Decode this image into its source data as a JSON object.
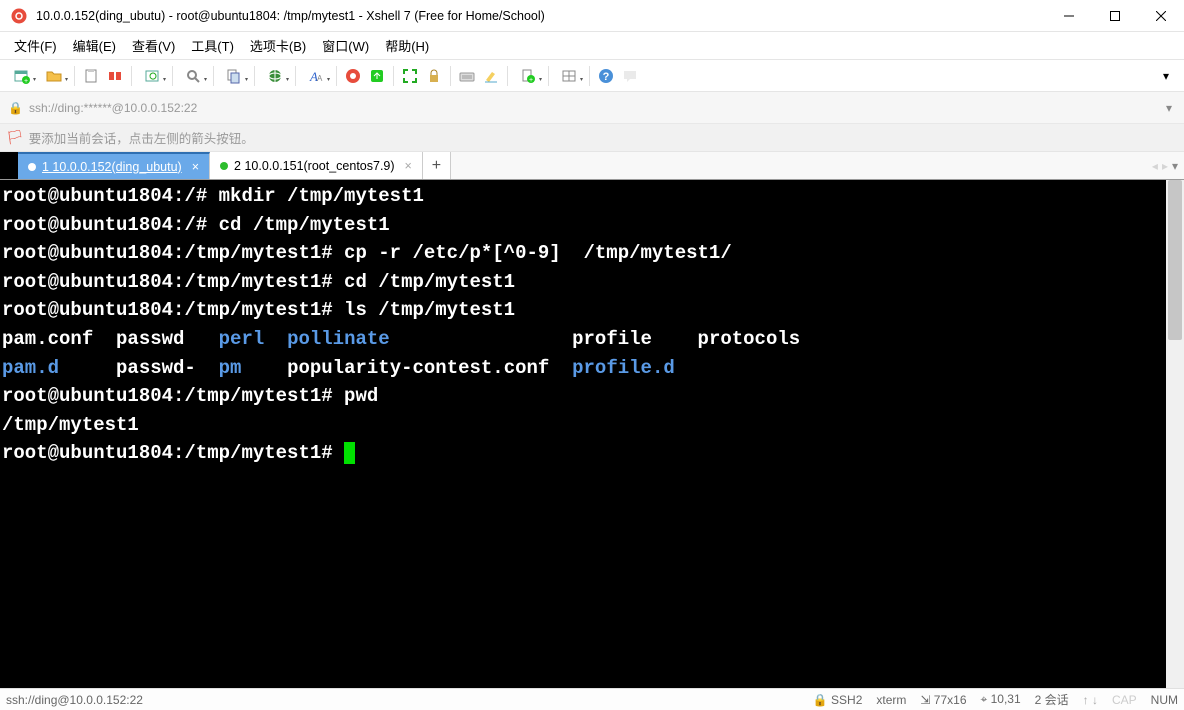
{
  "window": {
    "title": "10.0.0.152(ding_ubutu) - root@ubuntu1804: /tmp/mytest1 - Xshell 7 (Free for Home/School)"
  },
  "menu": {
    "items": [
      "文件(F)",
      "编辑(E)",
      "查看(V)",
      "工具(T)",
      "选项卡(B)",
      "窗口(W)",
      "帮助(H)"
    ]
  },
  "address": {
    "url": "ssh://ding:******@10.0.0.152:22"
  },
  "hint": {
    "text": "要添加当前会话，点击左侧的箭头按钮。"
  },
  "tabs": [
    {
      "label": "1 10.0.0.152(ding_ubutu)",
      "active": true
    },
    {
      "label": "2 10.0.0.151(root_centos7.9)",
      "active": false
    }
  ],
  "terminal": {
    "lines": [
      [
        {
          "t": "root@ubuntu1804:/# mkdir /tmp/mytest1"
        }
      ],
      [
        {
          "t": "root@ubuntu1804:/# cd /tmp/mytest1"
        }
      ],
      [
        {
          "t": "root@ubuntu1804:/tmp/mytest1# cp -r /etc/p*[^0-9]  /tmp/mytest1/"
        }
      ],
      [
        {
          "t": "root@ubuntu1804:/tmp/mytest1# cd /tmp/mytest1"
        }
      ],
      [
        {
          "t": "root@ubuntu1804:/tmp/mytest1# ls /tmp/mytest1"
        }
      ],
      [
        {
          "t": "pam.conf  passwd   "
        },
        {
          "t": "perl",
          "b": true
        },
        {
          "t": "  "
        },
        {
          "t": "pollinate",
          "b": true
        },
        {
          "t": "                profile    protocols"
        }
      ],
      [
        {
          "t": "pam.d",
          "b": true
        },
        {
          "t": "     passwd-  "
        },
        {
          "t": "pm",
          "b": true
        },
        {
          "t": "    popularity-contest.conf  "
        },
        {
          "t": "profile.d",
          "b": true
        }
      ],
      [
        {
          "t": "root@ubuntu1804:/tmp/mytest1# pwd"
        }
      ],
      [
        {
          "t": "/tmp/mytest1"
        }
      ],
      [
        {
          "t": "root@ubuntu1804:/tmp/mytest1# "
        },
        {
          "cursor": true
        }
      ]
    ]
  },
  "status": {
    "left": "ssh://ding@10.0.0.152:22",
    "proto": "SSH2",
    "term": "xterm",
    "size": "77x16",
    "pos": "10,31",
    "sessions": "2 会话",
    "caps": "CAP",
    "num": "NUM"
  }
}
